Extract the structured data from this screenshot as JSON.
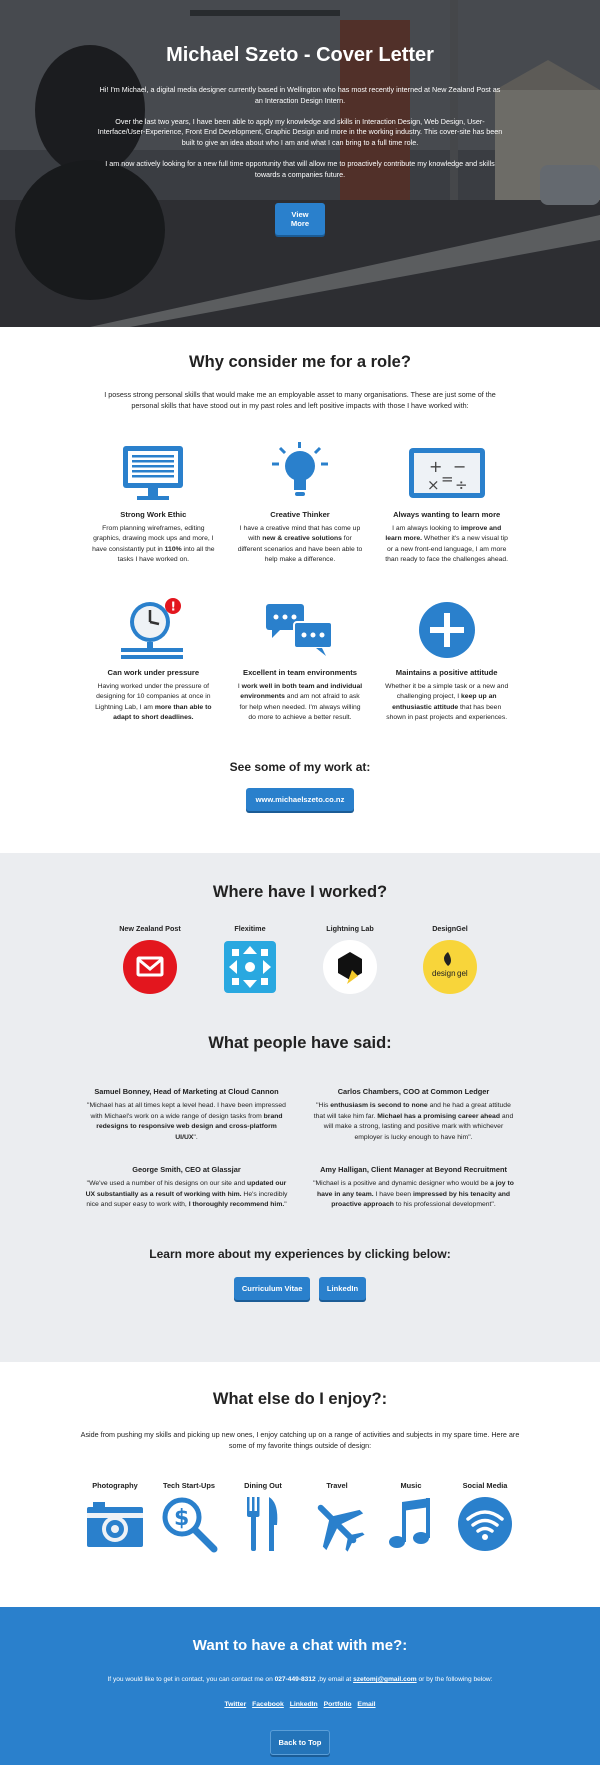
{
  "hero": {
    "title": "Michael Szeto - Cover Letter",
    "p1": "Hi! I'm Michael, a digital media designer currently based in Wellington who has most recently interned at New Zealand Post as an Interaction Design Intern.",
    "p2": "Over the last two years, I have been able to apply my knowledge and skills in Interaction Design, Web Design, User-Interface/User-Experience, Front End Development, Graphic Design and more in the working industry. This cover-site has been built to give an idea about who I am and what I can bring to a full time role.",
    "p3": "I am now actively looking for a new full time opportunity that will allow me to proactively contribute my knowledge and skills towards a companies future.",
    "button": "View More"
  },
  "why": {
    "title": "Why consider me for a role?",
    "intro": "I posess strong personal skills that would make me an employable asset to many organisations. These are just some of the personal skills that have stood out in my past roles and left positive impacts with those I have worked with:",
    "skills": [
      {
        "title": "Strong Work Ethic",
        "icon": "monitor-icon",
        "a": "From planning wireframes, editing graphics, drawing mock ups and more, I have consistantly put in ",
        "b": "110%",
        "c": " into all the tasks I have worked on."
      },
      {
        "title": "Creative Thinker",
        "icon": "lightbulb-icon",
        "a": "I have a creative mind that has come up with ",
        "b": "new & creative solutions",
        "c": " for different scenarios and have been able to help make a difference."
      },
      {
        "title": "Always wanting to learn more",
        "icon": "chalkboard-math-icon",
        "a": "I am always looking to ",
        "b": "improve and learn more.",
        "c": " Whether it's a new visual tip or a new front-end language, I am more than ready to face the challenges ahead."
      },
      {
        "title": "Can work under pressure",
        "icon": "clock-alert-icon",
        "a": "Having worked under the pressure of designing for 10 companies at once in Lightning Lab, I am ",
        "b": "more than able to adapt to short deadlines.",
        "c": ""
      },
      {
        "title": "Excellent in team environments",
        "icon": "chat-bubbles-icon",
        "a": "I ",
        "b": "work well in both team and individual environments",
        "c": " and am not afraid to ask for help when needed. I'm always willing do more to achieve a better result."
      },
      {
        "title": "Maintains a positive attitude",
        "icon": "plus-circle-icon",
        "a": "Whether it be a simple task or a new and challenging project, I ",
        "b": "keep up an enthusiastic attitude",
        "c": " that has been shown in past projects and experiences."
      }
    ],
    "work_title": "See some of my work at:",
    "work_button": "www.michaelszeto.co.nz"
  },
  "worked": {
    "title": "Where have I worked?",
    "places": [
      {
        "name": "New Zealand Post",
        "icon": "nzpost-logo-icon",
        "color": "#e3161e"
      },
      {
        "name": "Flexitime",
        "icon": "flexitime-logo-icon",
        "color": "#29a8e0"
      },
      {
        "name": "Lightning Lab",
        "icon": "lightning-lab-logo-icon",
        "color": "#ffffff"
      },
      {
        "name": "DesignGel",
        "icon": "designgel-logo-icon",
        "color": "#f8d53a",
        "logo_text_a": "design",
        "logo_text_b": "gel"
      }
    ],
    "said_title": "What people have said:",
    "testimonials": [
      {
        "name": "Samuel Bonney, Head of Marketing at Cloud Cannon",
        "a": "\"Michael has at all times kept a level head. I have been impressed with Michael's work on a wide range of design tasks from ",
        "b": "brand redesigns to responsive web design and cross-platform UI/UX",
        "c": "\"."
      },
      {
        "name": "Carlos Chambers, COO at Common Ledger",
        "a": "\"His ",
        "b": "enthusiasm is second to none",
        "c": " and he had a great attitude that will take him far. ",
        "d": "Michael has a promising career ahead",
        "e": " and will make a strong, lasting and positive mark with whichever employer is lucky enough to have him\"."
      },
      {
        "name": "George Smith, CEO at Glassjar",
        "a": "\"We've used a number of his designs on our site and ",
        "b": "updated our UX substantially as a result of working with him.",
        "c": " He's incredibly nice and super easy to work with, ",
        "d": "I thoroughly recommend him.",
        "e": "\""
      },
      {
        "name": "Amy Halligan, Client Manager at Beyond Recruitment",
        "a": "\"Michael is a positive and dynamic designer who would be ",
        "b": "a joy to have in any team.",
        "c": " I have been ",
        "d": "impressed by his tenacity and proactive approach",
        "e": " to his professional development\"."
      }
    ],
    "learn_title": "Learn more about my experiences by clicking below:",
    "cv_button": "Curriculum Vitae",
    "linkedin_button": "LinkedIn"
  },
  "enjoy": {
    "title": "What else do I enjoy?:",
    "intro": "Aside from pushing my skills and picking up new ones, I enjoy catching up on a range of activities and subjects in my spare time. Here are some of my favorite things outside of design:",
    "hobbies": [
      {
        "name": "Photography",
        "icon": "camera-icon"
      },
      {
        "name": "Tech Start-Ups",
        "icon": "dollar-magnifier-icon"
      },
      {
        "name": "Dining Out",
        "icon": "fork-knife-icon"
      },
      {
        "name": "Travel",
        "icon": "airplane-icon"
      },
      {
        "name": "Music",
        "icon": "music-note-icon"
      },
      {
        "name": "Social Media",
        "icon": "wifi-circle-icon"
      }
    ]
  },
  "footer": {
    "title": "Want to have a chat with me?:",
    "contact_a": "If you would like to get in contact, you can contact me on ",
    "phone": "027-449-8312",
    "contact_b": " ,by email at ",
    "email": "szetomj@gmail.com",
    "contact_c": " or by the following below:",
    "links": [
      "Twitter",
      "Facebook",
      "LinkedIn",
      "Portfolio",
      "Email"
    ],
    "back_button": "Back to Top"
  },
  "colors": {
    "accent": "#2a80cc",
    "alert": "#e3161e",
    "grey_bg": "#ebedf0"
  }
}
